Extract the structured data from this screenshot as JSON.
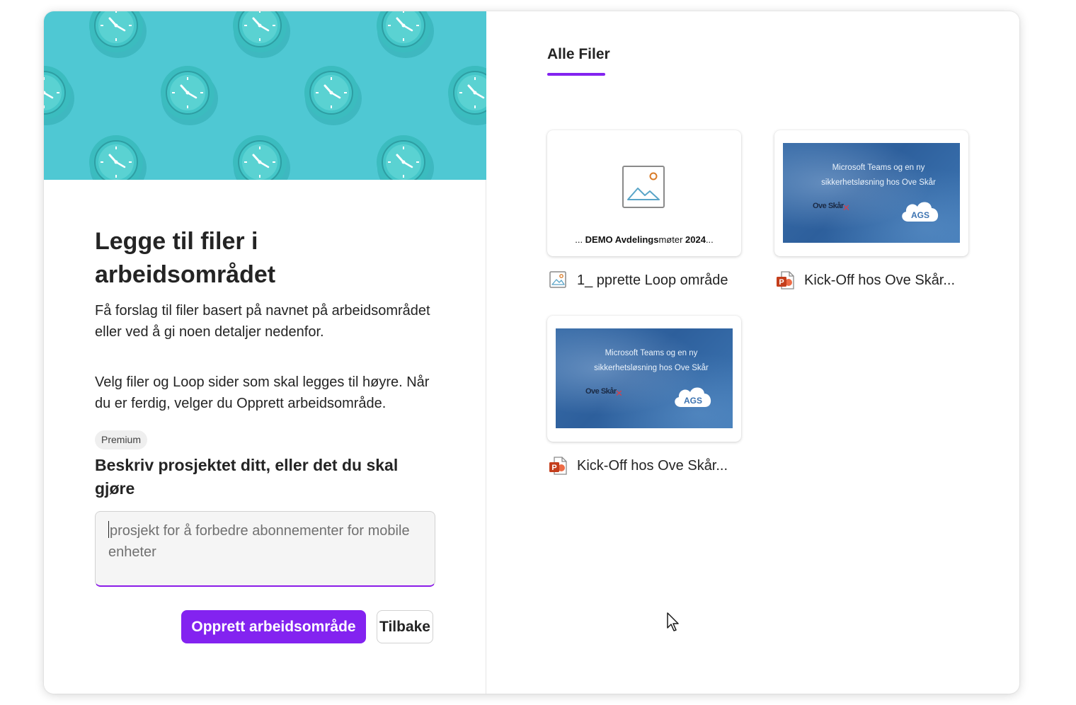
{
  "left_panel": {
    "title": "Legge til filer i arbeidsområdet",
    "description_1": "Få forslag til filer basert på navnet på arbeidsområdet eller ved å gi noen detaljer nedenfor.",
    "description_2": "Velg filer og Loop sider som skal legges til høyre. Når du er ferdig, velger du Opprett arbeidsområde.",
    "badge": "Premium",
    "prompt_label": "Beskriv prosjektet ditt, eller det du skal gjøre",
    "prompt_placeholder": "prosjekt for å forbedre abonnementer for mobile enheter",
    "create_button": "Opprett arbeidsområde",
    "back_button": "Tilbake"
  },
  "right_panel": {
    "tab_label": "Alle Filer",
    "files": [
      {
        "name": "1_ pprette Loop område",
        "type": "image",
        "icon": "image-file-icon",
        "preview_caption_prefix": "... ",
        "preview_caption_bold": "DEMO Avdelings",
        "preview_caption_mid": "møter ",
        "preview_caption_bold2": "2024",
        "preview_caption_suffix": "..."
      },
      {
        "name": "Kick-Off hos Ove Skår...",
        "type": "powerpoint",
        "icon": "powerpoint-file-icon",
        "thumb_text_1": "Microsoft Teams og en ny",
        "thumb_text_2": "sikkerhetsløsning hos Ove Skår",
        "thumb_logo": "Ove Skår",
        "thumb_cloud": "AGS"
      },
      {
        "name": "Kick-Off hos Ove Skår...",
        "type": "powerpoint",
        "icon": "powerpoint-file-icon",
        "thumb_text_1": "Microsoft Teams og en ny",
        "thumb_text_2": "sikkerhetsløsning hos Ove Skår",
        "thumb_logo": "Ove Skår",
        "thumb_cloud": "AGS"
      }
    ]
  },
  "colors": {
    "accent": "#8323f0",
    "hero_bg": "#4fc8d3",
    "clock": "#38b8b8",
    "powerpoint": "#c43e1c"
  }
}
